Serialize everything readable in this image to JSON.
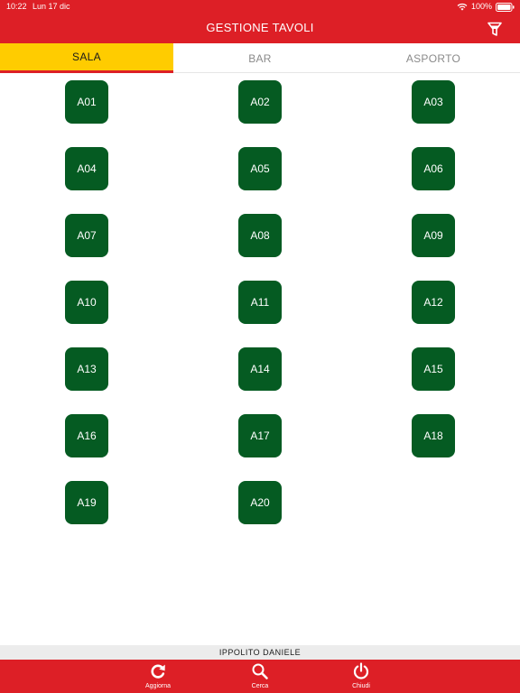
{
  "status_bar": {
    "time": "10:22",
    "date": "Lun 17 dic",
    "battery": "100%"
  },
  "header": {
    "title": "GESTIONE TAVOLI",
    "filter_icon": "filter-icon"
  },
  "tabs": [
    {
      "label": "SALA",
      "active": true
    },
    {
      "label": "BAR",
      "active": false
    },
    {
      "label": "ASPORTO",
      "active": false
    }
  ],
  "tables": [
    "A01",
    "A02",
    "A03",
    "A04",
    "A05",
    "A06",
    "A07",
    "A08",
    "A09",
    "A10",
    "A11",
    "A12",
    "A13",
    "A14",
    "A15",
    "A16",
    "A17",
    "A18",
    "A19",
    "A20"
  ],
  "user": "IPPOLITO DANIELE",
  "toolbar": {
    "refresh_label": "Aggiorna",
    "search_label": "Cerca",
    "close_label": "Chiudi"
  },
  "colors": {
    "brand_red": "#dd1f26",
    "tab_active": "#ffcc00",
    "table_green": "#055b22"
  }
}
